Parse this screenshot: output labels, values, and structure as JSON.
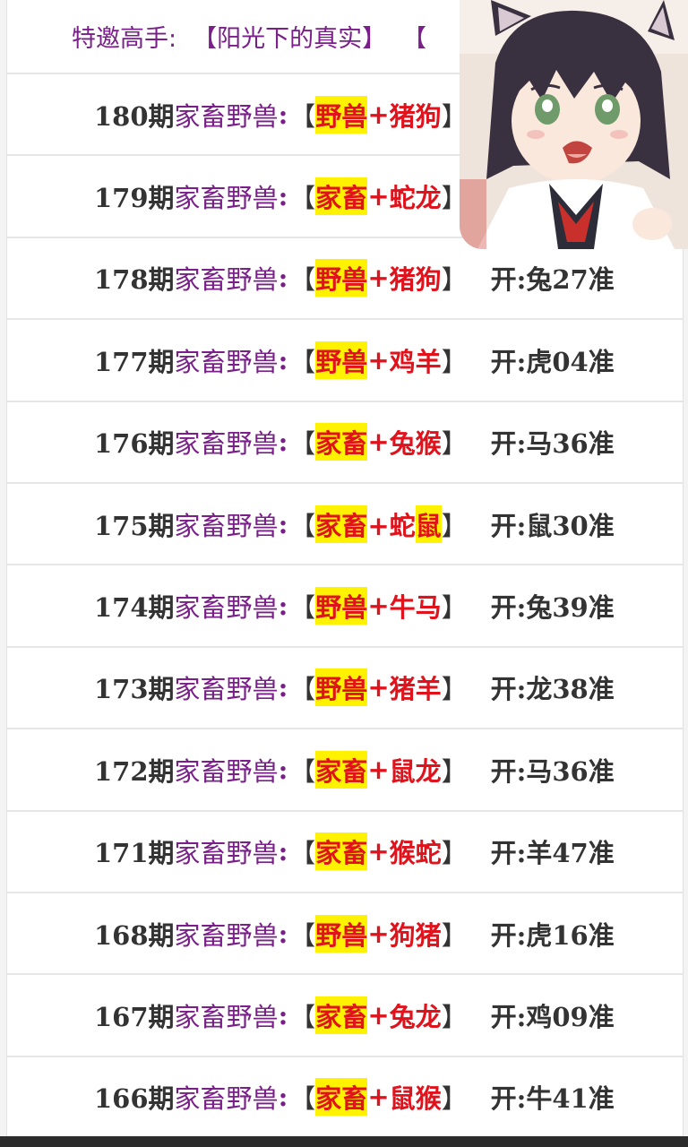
{
  "header": {
    "label": "特邀高手:",
    "title": "【阳光下的真实】",
    "trailing": "【"
  },
  "rows": [
    {
      "issue": "180期",
      "category": "家畜野兽",
      "open": "【",
      "pick_a": "野兽",
      "plus": "+",
      "pick_b": "猪狗",
      "close": "】",
      "result": ""
    },
    {
      "issue": "179期",
      "category": "家畜野兽",
      "open": "【",
      "pick_a": "家畜",
      "plus": "+",
      "pick_b": "蛇龙",
      "close": "】",
      "result": ""
    },
    {
      "issue": "178期",
      "category": "家畜野兽",
      "open": "【",
      "pick_a": "野兽",
      "plus": "+",
      "pick_b": "猪狗",
      "close": "】",
      "result": "开:兔27准"
    },
    {
      "issue": "177期",
      "category": "家畜野兽",
      "open": "【",
      "pick_a": "野兽",
      "plus": "+",
      "pick_b": "鸡羊",
      "close": "】",
      "result": "开:虎04准"
    },
    {
      "issue": "176期",
      "category": "家畜野兽",
      "open": "【",
      "pick_a": "家畜",
      "plus": "+",
      "pick_b": "兔猴",
      "close": "】",
      "result": "开:马36准"
    },
    {
      "issue": "175期",
      "category": "家畜野兽",
      "open": "【",
      "pick_a": "家畜",
      "plus": "+蛇",
      "pick_b": "鼠",
      "close": "】",
      "result": "开:鼠30准"
    },
    {
      "issue": "174期",
      "category": "家畜野兽",
      "open": "【",
      "pick_a": "野兽",
      "plus": "+",
      "pick_b": "牛马",
      "close": "】",
      "result": "开:兔39准"
    },
    {
      "issue": "173期",
      "category": "家畜野兽",
      "open": "【",
      "pick_a": "野兽",
      "plus": "+",
      "pick_b": "猪羊",
      "close": "】",
      "result": "开:龙38准"
    },
    {
      "issue": "172期",
      "category": "家畜野兽",
      "open": "【",
      "pick_a": "家畜",
      "plus": "+",
      "pick_b": "鼠龙",
      "close": "】",
      "result": "开:马36准"
    },
    {
      "issue": "171期",
      "category": "家畜野兽",
      "open": "【",
      "pick_a": "家畜",
      "plus": "+",
      "pick_b": "猴蛇",
      "close": "】",
      "result": "开:羊47准"
    },
    {
      "issue": "168期",
      "category": "家畜野兽",
      "open": "【",
      "pick_a": "野兽",
      "plus": "+",
      "pick_b": "狗猪",
      "close": "】",
      "result": "开:虎16准"
    },
    {
      "issue": "167期",
      "category": "家畜野兽",
      "open": "【",
      "pick_a": "家畜",
      "plus": "+",
      "pick_b": "兔龙",
      "close": "】",
      "result": "开:鸡09准"
    },
    {
      "issue": "166期",
      "category": "家畜野兽",
      "open": "【",
      "pick_a": "家畜",
      "plus": "+",
      "pick_b": "鼠猴",
      "close": "】",
      "result": "开:牛41准"
    }
  ],
  "colors": {
    "category_purple": "#7a1f8a",
    "pick_red": "#e0121b",
    "highlight_yellow": "#fff200",
    "text_dark": "#333333"
  },
  "avatar": {
    "icon": "anime-catgirl-avatar"
  }
}
